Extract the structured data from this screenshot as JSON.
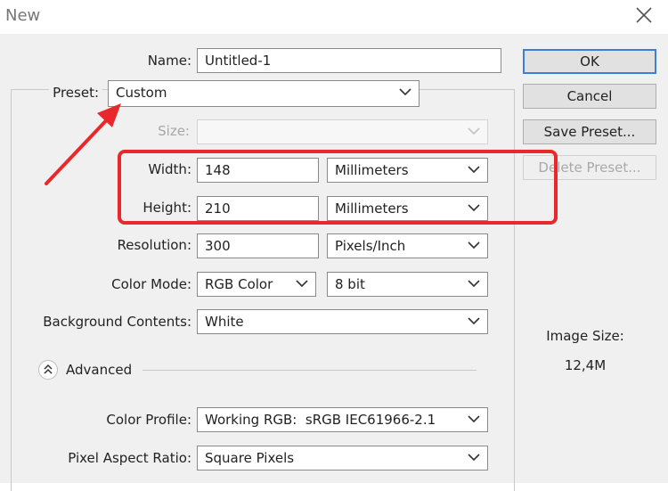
{
  "window": {
    "title": "New",
    "close_icon": "close-icon"
  },
  "name": {
    "label": "Name:",
    "value": "Untitled-1"
  },
  "preset": {
    "label": "Preset:",
    "value": "Custom"
  },
  "size": {
    "label": "Size:",
    "value": ""
  },
  "width": {
    "label": "Width:",
    "value": "148",
    "unit": "Millimeters"
  },
  "height": {
    "label": "Height:",
    "value": "210",
    "unit": "Millimeters"
  },
  "resolution": {
    "label": "Resolution:",
    "value": "300",
    "unit": "Pixels/Inch"
  },
  "color_mode": {
    "label": "Color Mode:",
    "value": "RGB Color",
    "depth": "8 bit"
  },
  "background": {
    "label": "Background Contents:",
    "value": "White"
  },
  "advanced": {
    "label": "Advanced"
  },
  "color_profile": {
    "label": "Color Profile:",
    "value": "Working RGB:  sRGB IEC61966-2.1"
  },
  "pixel_aspect": {
    "label": "Pixel Aspect Ratio:",
    "value": "Square Pixels"
  },
  "buttons": {
    "ok": "OK",
    "cancel": "Cancel",
    "save_preset": "Save Preset...",
    "delete_preset": "Delete Preset..."
  },
  "image_size": {
    "label": "Image Size:",
    "value": "12,4M"
  },
  "annotation": {
    "color": "#e8282b"
  }
}
